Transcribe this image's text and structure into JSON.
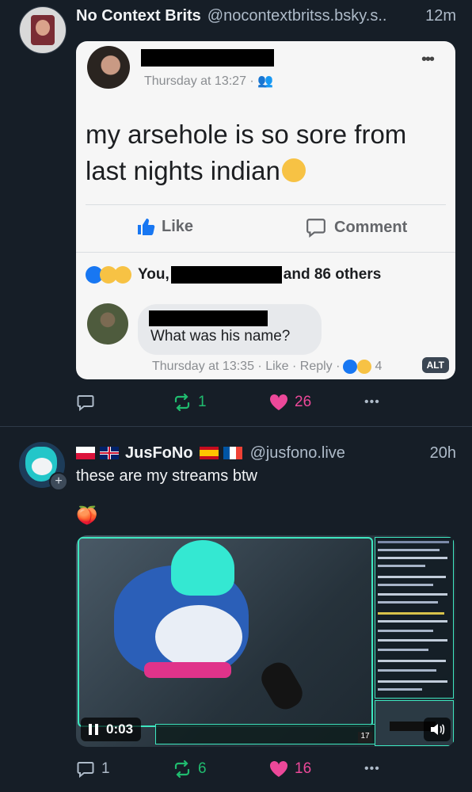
{
  "post1": {
    "author": "No Context Brits",
    "handle": "@nocontextbritss.bsky.s..",
    "time": "12m",
    "image": {
      "timestamp": "Thursday at 13:27 · ",
      "status": "my arsehole is so sore from last nights indian",
      "like_label": "Like",
      "comment_label": "Comment",
      "reactions_you": "You,",
      "reactions_others": "and 86 others",
      "reply_text": "What was his name?",
      "reply_meta": "Thursday at 13:35 · Like · Reply ·",
      "reply_count": "4",
      "alt_badge": "ALT"
    },
    "actions": {
      "reposts": "1",
      "likes": "26"
    }
  },
  "post2": {
    "author": "JusFoNo",
    "handle": "@jusfono.live",
    "time": "20h",
    "text": "these are my streams btw",
    "emoji": "🍑",
    "video": {
      "time": "0:03",
      "hud_count": "17"
    },
    "actions": {
      "replies": "1",
      "reposts": "6",
      "likes": "16"
    }
  },
  "colors": {
    "background": "#161e27",
    "accent": "#20bc6f",
    "like": "#ec4899",
    "muted": "#aebbc9"
  }
}
